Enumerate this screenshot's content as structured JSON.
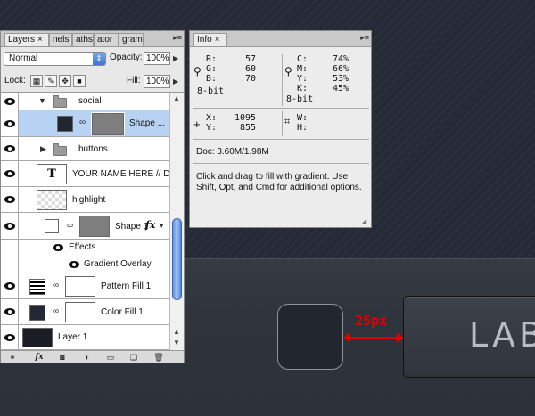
{
  "canvas": {
    "measure_label": "25px",
    "button_label": "LAB"
  },
  "layers_panel": {
    "tabs": [
      "Layers",
      "nels",
      "aths",
      "ator",
      "gram"
    ],
    "tab_close": "×",
    "blend_mode": "Normal",
    "opacity_label": "Opacity:",
    "opacity_value": "100%",
    "lock_label": "Lock:",
    "fill_label": "Fill:",
    "fill_value": "100%",
    "layers": [
      {
        "name": "social",
        "type": "group",
        "expanded": true
      },
      {
        "name": "Shape ...",
        "type": "shape",
        "selected": true
      },
      {
        "name": "buttons",
        "type": "group",
        "expanded": false
      },
      {
        "name": "YOUR NAME HERE  //  D...",
        "type": "text"
      },
      {
        "name": "highlight",
        "type": "pixel"
      },
      {
        "name": "Shape 1",
        "type": "shape",
        "fx": true
      },
      {
        "name": "Effects",
        "type": "effects"
      },
      {
        "name": "Gradient Overlay",
        "type": "effect"
      },
      {
        "name": "Pattern Fill 1",
        "type": "fill"
      },
      {
        "name": "Color Fill 1",
        "type": "fill"
      },
      {
        "name": "Layer 1",
        "type": "pixel"
      }
    ],
    "fx_symbol": "fx",
    "text_layer_glyph": "T"
  },
  "info_panel": {
    "tab": "Info",
    "tab_close": "×",
    "rgb": {
      "r_label": "R:",
      "r": "57",
      "g_label": "G:",
      "g": "60",
      "b_label": "B:",
      "b": "70"
    },
    "cmyk": {
      "c_label": "C:",
      "c": "74%",
      "m_label": "M:",
      "m": "66%",
      "y_label": "Y:",
      "y": "53%",
      "k_label": "K:",
      "k": "45%"
    },
    "bit_left": "8-bit",
    "bit_right": "8-bit",
    "xy": {
      "x_label": "X:",
      "x": "1095",
      "y_label": "Y:",
      "y": "855"
    },
    "wh": {
      "w_label": "W:",
      "h_label": "H:"
    },
    "doc": "Doc: 3.60M/1.98M",
    "hint_line1": "Click and drag to fill with gradient.  Use",
    "hint_line2": "Shift, Opt, and Cmd for additional options."
  },
  "colors": {
    "canvas_bg": "#252a36",
    "band_bg": "#31353d",
    "measure_red": "#e00000",
    "selection_blue": "#b8d2f3"
  },
  "icons": [
    "eye-icon",
    "folder-icon",
    "chain-link-icon",
    "eyedropper-icon",
    "crosshair-icon",
    "marquee-icon",
    "trash-icon",
    "new-layer-icon",
    "mask-icon",
    "adjustment-icon",
    "link-icon",
    "fx-icon",
    "lock-icon",
    "move-icon",
    "brush-icon"
  ]
}
